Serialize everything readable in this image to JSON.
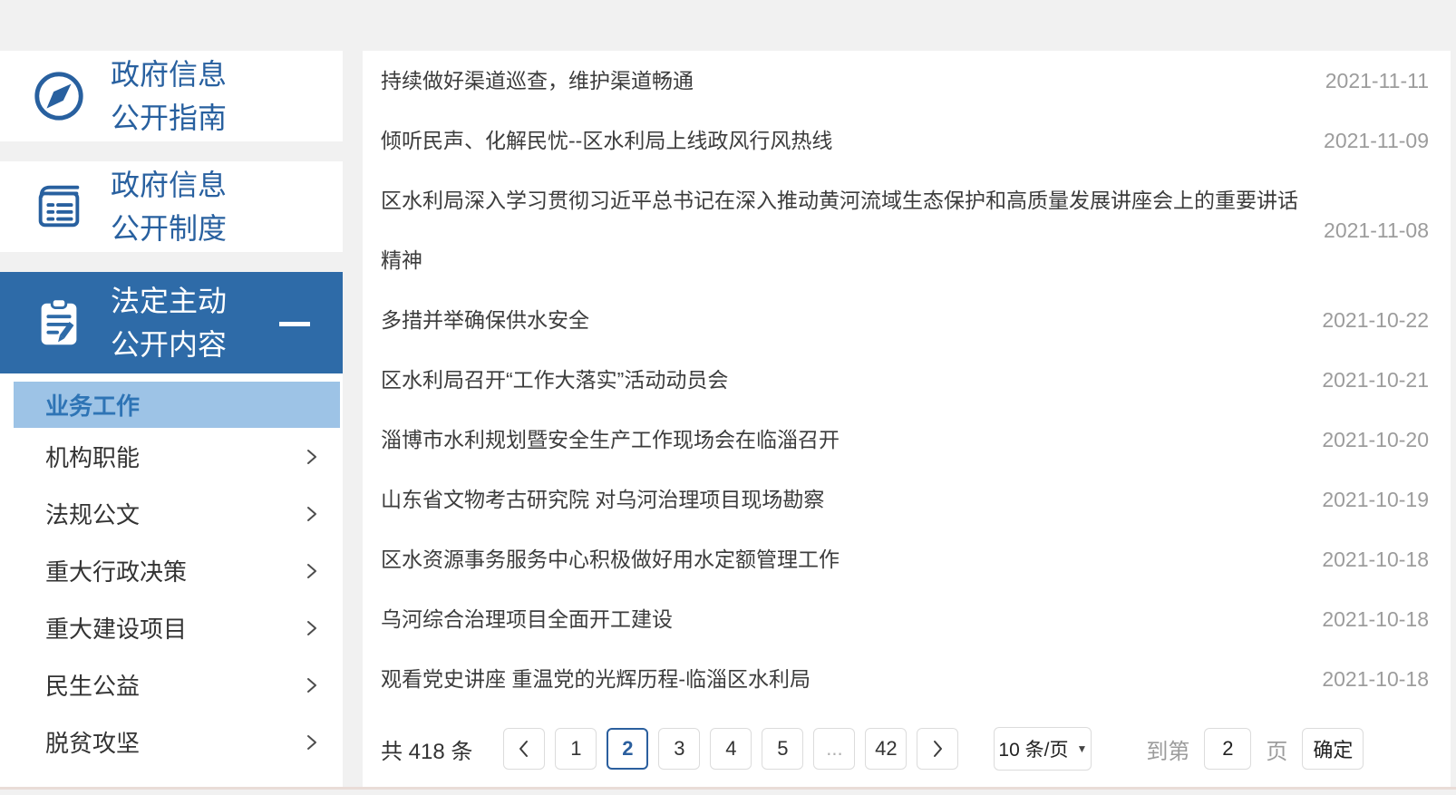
{
  "sidebar": {
    "top_items": [
      {
        "line1": "政府信息",
        "line2": "公开指南",
        "icon": "compass-icon"
      },
      {
        "line1": "政府信息",
        "line2": "公开制度",
        "icon": "notebook-icon"
      }
    ],
    "active_section": {
      "line1": "法定主动",
      "line2": "公开内容",
      "icon": "clipboard-pen-icon",
      "collapse_indicator": "minus-icon"
    },
    "submenu": {
      "active_item": "业务工作",
      "items": [
        {
          "label": "机构职能"
        },
        {
          "label": "法规公文"
        },
        {
          "label": "重大行政决策"
        },
        {
          "label": "重大建设项目"
        },
        {
          "label": "民生公益"
        },
        {
          "label": "脱贫攻坚"
        }
      ]
    }
  },
  "news_list": [
    {
      "title": "持续做好渠道巡查，维护渠道畅通",
      "date": "2021-11-11"
    },
    {
      "title": "倾听民声、化解民忧--区水利局上线政风行风热线",
      "date": "2021-11-09"
    },
    {
      "title": "区水利局深入学习贯彻习近平总书记在深入推动黄河流域生态保护和高质量发展讲座会上的重要讲话精神",
      "date": "2021-11-08"
    },
    {
      "title": "多措并举确保供水安全",
      "date": "2021-10-22"
    },
    {
      "title": "区水利局召开“工作大落实”活动动员会",
      "date": "2021-10-21"
    },
    {
      "title": "淄博市水利规划暨安全生产工作现场会在临淄召开",
      "date": "2021-10-20"
    },
    {
      "title": "山东省文物考古研究院 对乌河治理项目现场勘察",
      "date": "2021-10-19"
    },
    {
      "title": "区水资源事务服务中心积极做好用水定额管理工作",
      "date": "2021-10-18"
    },
    {
      "title": "乌河综合治理项目全面开工建设",
      "date": "2021-10-18"
    },
    {
      "title": "观看党史讲座 重温党的光辉历程-临淄区水利局",
      "date": "2021-10-18"
    }
  ],
  "pagination": {
    "total_label": "共 418 条",
    "pages": [
      "1",
      "2",
      "3",
      "4",
      "5",
      "...",
      "42"
    ],
    "active_page": "2",
    "page_size": "10 条/页",
    "goto_prefix": "到第",
    "goto_value": "2",
    "goto_suffix": "页",
    "confirm_label": "确定"
  },
  "colors": {
    "accent": "#2e6ba8",
    "accent_light": "#9dc3e6",
    "link_blue": "#28609f",
    "submenu_active_text": "#2e74b5",
    "date_gray": "#9c9c9c",
    "page_background": "#f1f1f1"
  }
}
